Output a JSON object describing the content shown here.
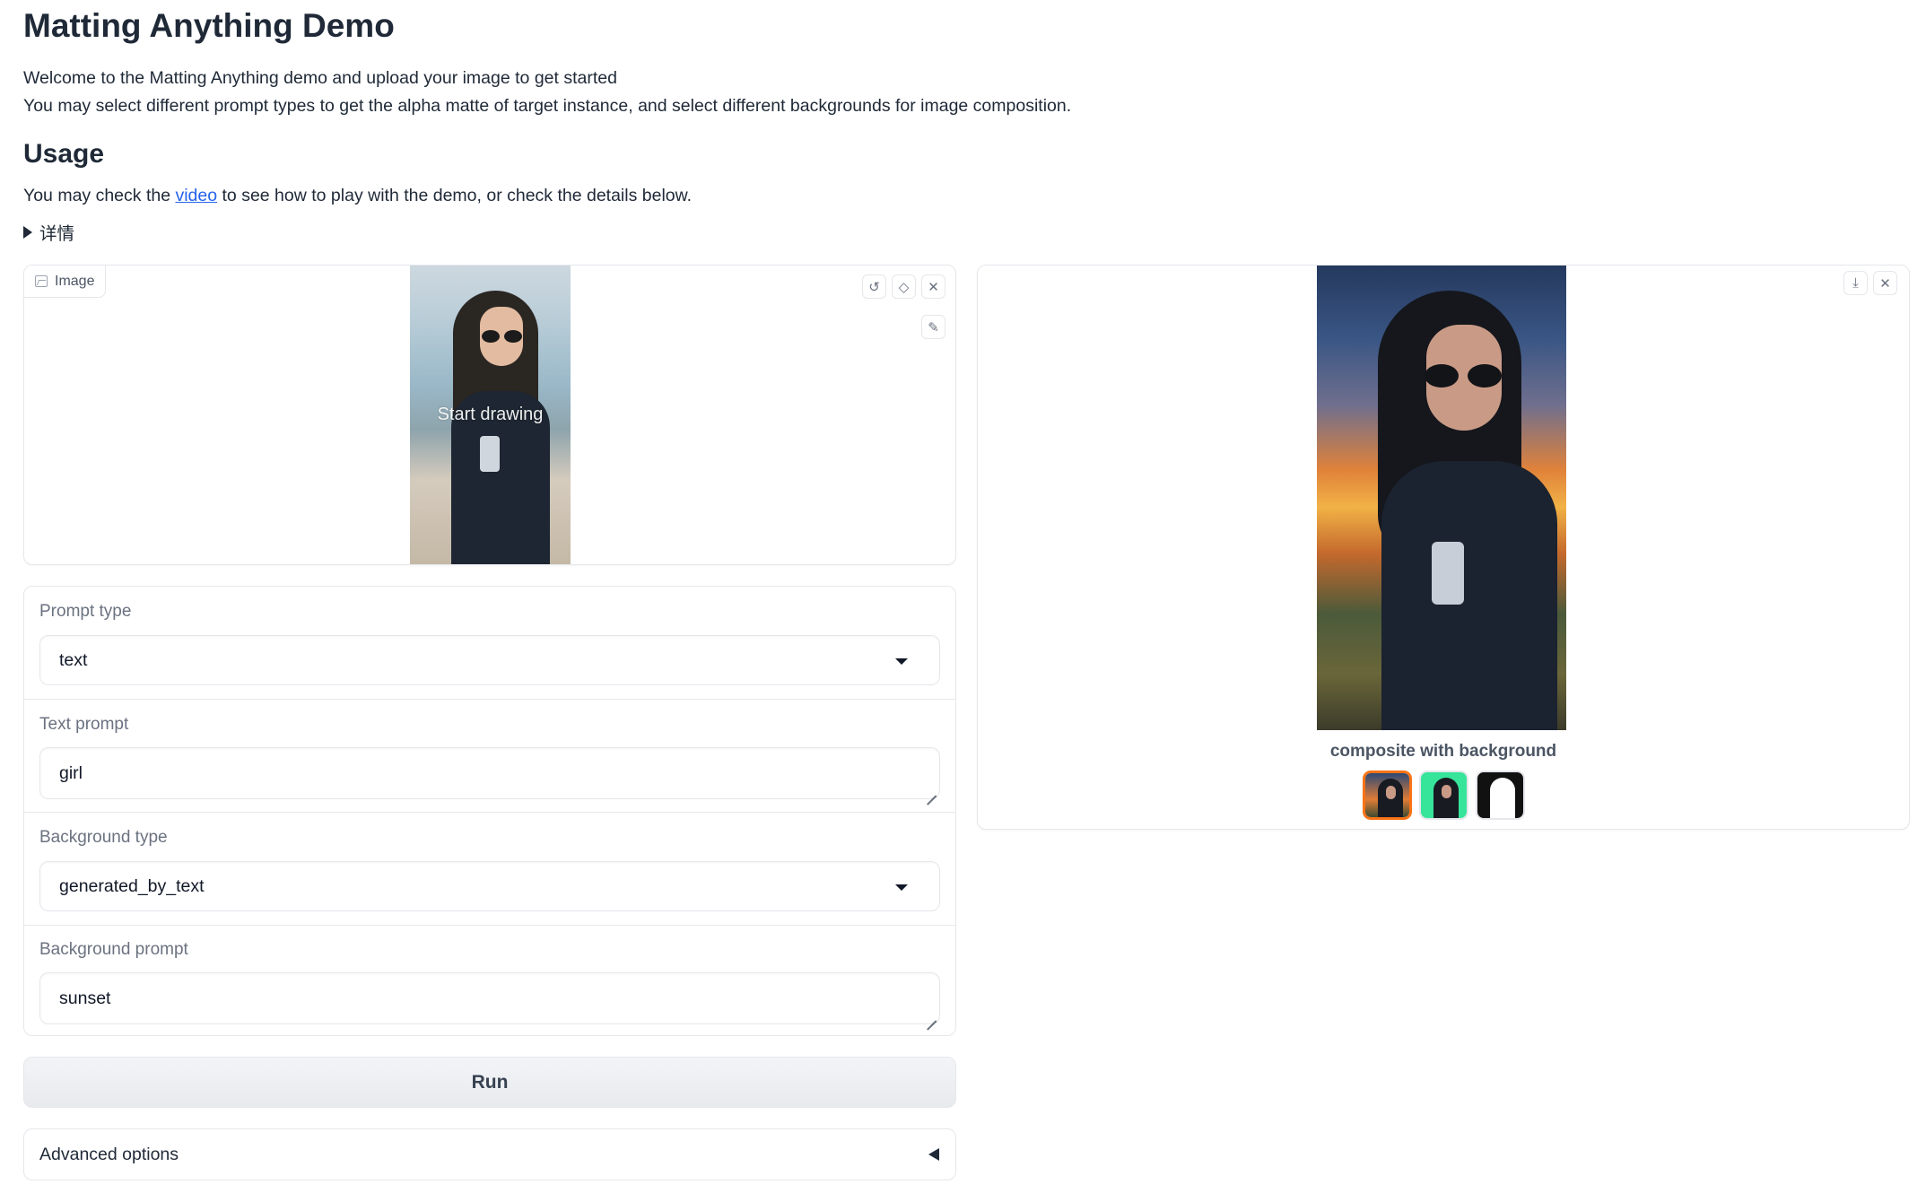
{
  "header": {
    "title": "Matting Anything Demo",
    "intro_line1": "Welcome to the Matting Anything demo and upload your image to get started",
    "intro_line2": "You may select different prompt types to get the alpha matte of target instance, and select different backgrounds for image composition."
  },
  "usage": {
    "heading": "Usage",
    "text_before": "You may check the ",
    "link_text": "video",
    "text_after": " to see how to play with the demo, or check the details below.",
    "details_label": "详情"
  },
  "input_image": {
    "label": "Image",
    "overlay_text": "Start drawing",
    "icons": [
      "undo-icon",
      "eraser-icon",
      "close-icon",
      "brush-icon"
    ]
  },
  "form": {
    "prompt_type": {
      "label": "Prompt type",
      "value": "text"
    },
    "text_prompt": {
      "label": "Text prompt",
      "value": "girl"
    },
    "background_type": {
      "label": "Background type",
      "value": "generated_by_text"
    },
    "background_prompt": {
      "label": "Background prompt",
      "value": "sunset"
    }
  },
  "actions": {
    "run_label": "Run",
    "advanced_label": "Advanced options"
  },
  "output": {
    "caption": "composite with background",
    "icons": [
      "download-icon",
      "close-icon"
    ],
    "thumbnails": [
      "composite-thumbnail",
      "green-screen-thumbnail",
      "alpha-matte-thumbnail"
    ],
    "selected_thumbnail": 0
  },
  "colors": {
    "accent": "#f97316",
    "link": "#2563eb",
    "border": "#e5e7eb"
  }
}
